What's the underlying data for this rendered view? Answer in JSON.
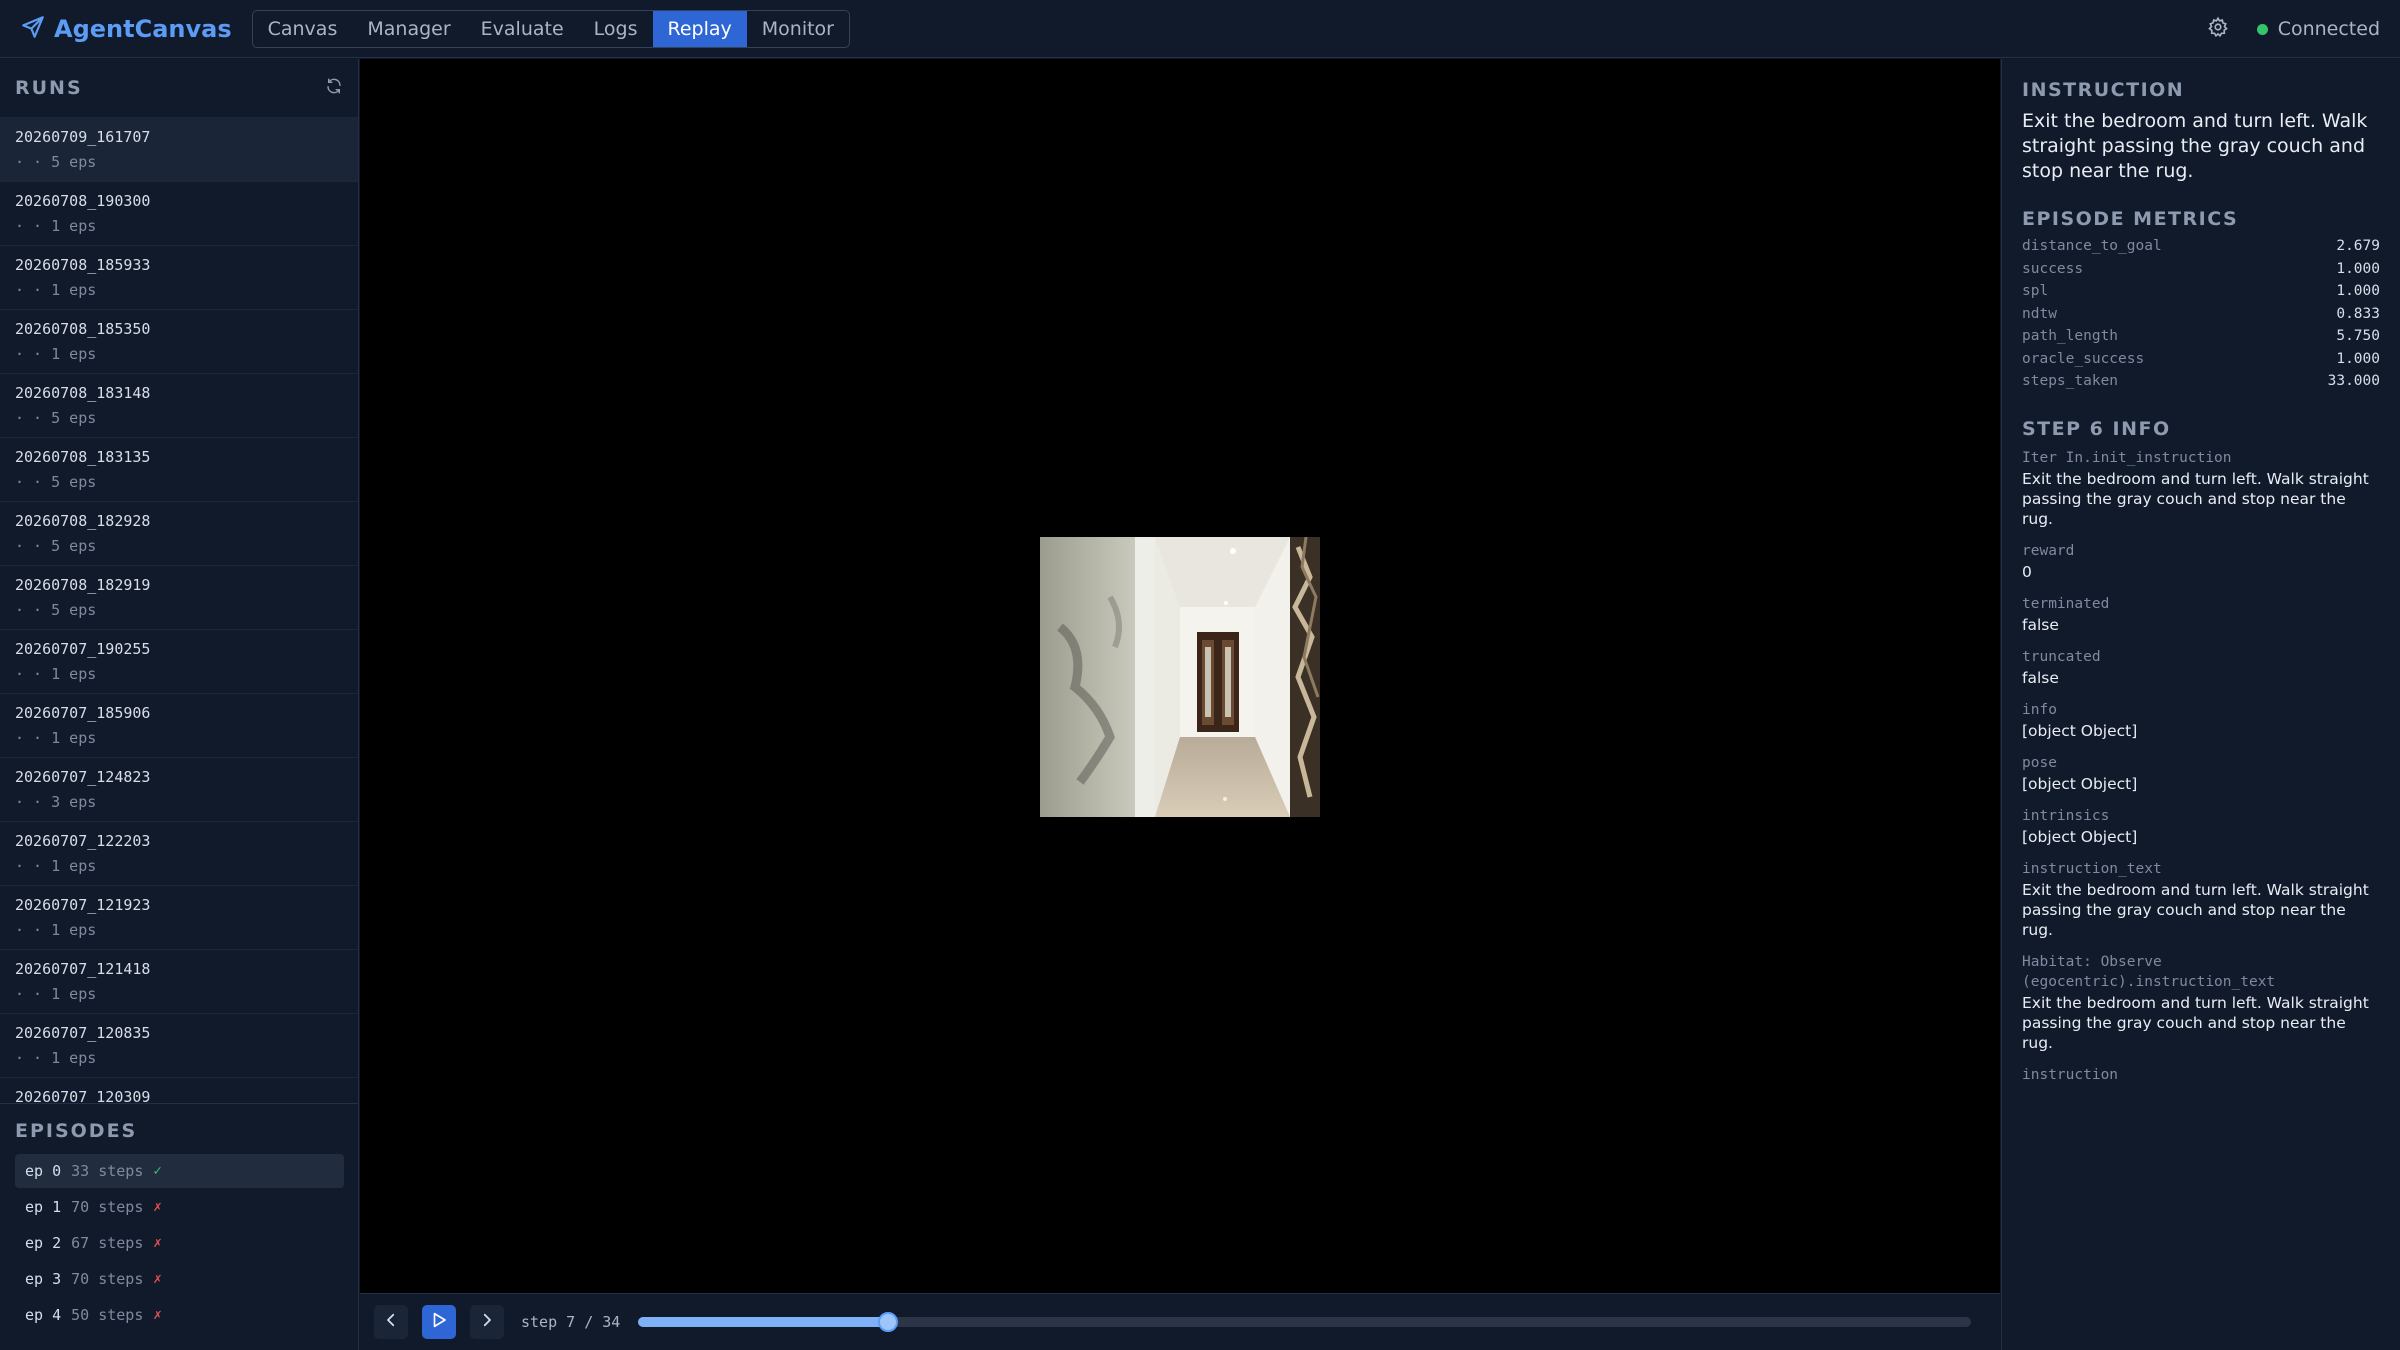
{
  "app": {
    "name": "AgentCanvas",
    "logo_icon": "paper-plane-icon",
    "accent": "#5b9cf5"
  },
  "nav": {
    "tabs": [
      {
        "label": "Canvas"
      },
      {
        "label": "Manager"
      },
      {
        "label": "Evaluate"
      },
      {
        "label": "Logs"
      },
      {
        "label": "Replay",
        "active": true
      },
      {
        "label": "Monitor"
      }
    ]
  },
  "status": {
    "label": "Connected",
    "color": "#34c46b",
    "settings_icon": "gear-icon"
  },
  "runs": {
    "title": "RUNS",
    "refresh_icon": "refresh-icon",
    "items": [
      {
        "id": "20260709_161707",
        "eps": "· · 5 eps",
        "selected": true
      },
      {
        "id": "20260708_190300",
        "eps": "· · 1 eps"
      },
      {
        "id": "20260708_185933",
        "eps": "· · 1 eps"
      },
      {
        "id": "20260708_185350",
        "eps": "· · 1 eps"
      },
      {
        "id": "20260708_183148",
        "eps": "· · 5 eps"
      },
      {
        "id": "20260708_183135",
        "eps": "· · 5 eps"
      },
      {
        "id": "20260708_182928",
        "eps": "· · 5 eps"
      },
      {
        "id": "20260708_182919",
        "eps": "· · 5 eps"
      },
      {
        "id": "20260707_190255",
        "eps": "· · 1 eps"
      },
      {
        "id": "20260707_185906",
        "eps": "· · 1 eps"
      },
      {
        "id": "20260707_124823",
        "eps": "· · 3 eps"
      },
      {
        "id": "20260707_122203",
        "eps": "· · 1 eps"
      },
      {
        "id": "20260707_121923",
        "eps": "· · 1 eps"
      },
      {
        "id": "20260707_121418",
        "eps": "· · 1 eps"
      },
      {
        "id": "20260707_120835",
        "eps": "· · 1 eps"
      },
      {
        "id": "20260707_120309",
        "eps": ""
      }
    ]
  },
  "episodes": {
    "title": "EPISODES",
    "items": [
      {
        "label": "ep 0",
        "steps": "33 steps",
        "result": "✓",
        "ok": true,
        "selected": true
      },
      {
        "label": "ep 1",
        "steps": "70 steps",
        "result": "✗",
        "ok": false
      },
      {
        "label": "ep 2",
        "steps": "67 steps",
        "result": "✗",
        "ok": false
      },
      {
        "label": "ep 3",
        "steps": "70 steps",
        "result": "✗",
        "ok": false
      },
      {
        "label": "ep 4",
        "steps": "50 steps",
        "result": "✗",
        "ok": false
      }
    ]
  },
  "player": {
    "step_text": "step 7 / 34",
    "progress": 0.1875,
    "prev_icon": "chevron-left-icon",
    "play_icon": "play-icon",
    "next_icon": "chevron-right-icon"
  },
  "instruction": {
    "title": "INSTRUCTION",
    "text": "Exit the bedroom and turn left. Walk straight passing the gray couch and stop near the rug."
  },
  "metrics": {
    "title": "EPISODE METRICS",
    "rows": [
      {
        "key": "distance_to_goal",
        "value": "2.679"
      },
      {
        "key": "success",
        "value": "1.000"
      },
      {
        "key": "spl",
        "value": "1.000"
      },
      {
        "key": "ndtw",
        "value": "0.833"
      },
      {
        "key": "path_length",
        "value": "5.750"
      },
      {
        "key": "oracle_success",
        "value": "1.000"
      },
      {
        "key": "steps_taken",
        "value": "33.000"
      }
    ]
  },
  "step_info": {
    "title": "STEP 6 INFO",
    "fields": [
      {
        "key": "Iter In.init_instruction",
        "value": "Exit the bedroom and turn left. Walk straight passing the gray couch and stop near the rug."
      },
      {
        "key": "reward",
        "value": "0"
      },
      {
        "key": "terminated",
        "value": "false"
      },
      {
        "key": "truncated",
        "value": "false"
      },
      {
        "key": "info",
        "value": "[object Object]"
      },
      {
        "key": "pose",
        "value": "[object Object]"
      },
      {
        "key": "intrinsics",
        "value": "[object Object]"
      },
      {
        "key": "instruction_text",
        "value": "Exit the bedroom and turn left. Walk straight passing the gray couch and stop near the rug."
      },
      {
        "key": "Habitat: Observe (egocentric).instruction_text",
        "value": "Exit the bedroom and turn left. Walk straight passing the gray couch and stop near the rug."
      },
      {
        "key": "instruction",
        "value": ""
      }
    ]
  }
}
